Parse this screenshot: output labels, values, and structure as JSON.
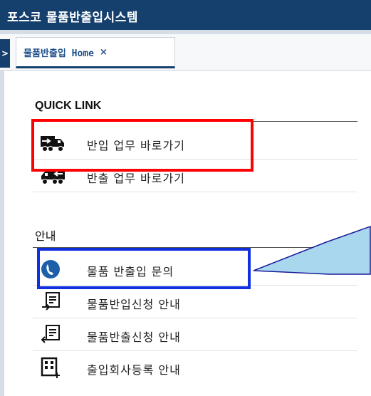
{
  "app": {
    "title": "포스코 물품반출입시스템"
  },
  "tabs": [
    {
      "label": "물품반출입 Home",
      "close": "×"
    }
  ],
  "sidebar_toggle": ">",
  "quick_link": {
    "heading": "QUICK LINK",
    "items": [
      {
        "label": "반입 업무 바로가기",
        "icon": "truck-in-icon"
      },
      {
        "label": "반출 업무 바로가기",
        "icon": "truck-out-icon"
      }
    ]
  },
  "info": {
    "heading": "안내",
    "items": [
      {
        "label": "물품 반출입 문의",
        "icon": "phone-icon"
      },
      {
        "label": "물품반입신청 안내",
        "icon": "document-in-icon"
      },
      {
        "label": "물품반출신청 안내",
        "icon": "document-out-icon"
      },
      {
        "label": "출입회사등록 안내",
        "icon": "building-icon"
      }
    ]
  },
  "colors": {
    "header_bg": "#15406e",
    "highlight_red": "#ff0000",
    "highlight_blue": "#1030e0",
    "callout_fill": "#a9d8ee",
    "phone_icon_bg": "#1d5fa8"
  }
}
